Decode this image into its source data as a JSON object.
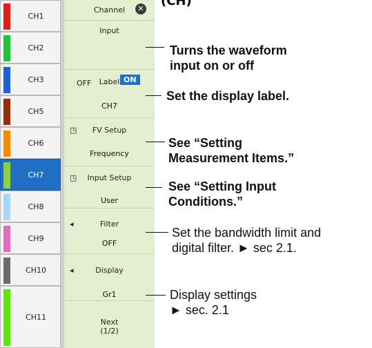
{
  "header_fragment": "(CH)",
  "channels": [
    {
      "label": "CH1",
      "color": "#e81b1b"
    },
    {
      "label": "CH2",
      "color": "#1ec43a"
    },
    {
      "label": "CH3",
      "color": "#1c5fe0"
    },
    {
      "label": "CH5",
      "color": "#9b2d05"
    },
    {
      "label": "CH6",
      "color": "#ff8a00"
    },
    {
      "label": "CH7",
      "color": "#8fd23a"
    },
    {
      "label": "CH8",
      "color": "#a7d6ff"
    },
    {
      "label": "CH9",
      "color": "#e869c2"
    },
    {
      "label": "CH10",
      "color": "#6a6a6a"
    },
    {
      "label": "CH11",
      "color": "#5ce60f"
    }
  ],
  "menu": {
    "title": "Channel",
    "input": {
      "title": "Input",
      "off": "OFF",
      "on": "ON"
    },
    "label": {
      "title": "Label",
      "value": "CH7"
    },
    "fv_setup": {
      "title": "FV Setup",
      "value": "Frequency"
    },
    "input_setup": {
      "title": "Input Setup",
      "value": "User"
    },
    "filter": {
      "title": "Filter",
      "value": "OFF"
    },
    "display": {
      "title": "Display",
      "value": "Gr1"
    },
    "next": {
      "line1": "Next",
      "line2": "(1/2)"
    }
  },
  "annotations": {
    "input_1": "Turns the waveform",
    "input_2": "input on or off",
    "label": "Set the display label.",
    "fv_1": "See “Setting",
    "fv_2": "Measurement Items.”",
    "is_1": "See “Setting Input",
    "is_2": "Conditions.”",
    "filter_1": "Set the bandwidth limit and",
    "filter_2": "digital filter. ► sec 2.1.",
    "display_1": "Display settings",
    "display_2": "► sec. 2.1"
  },
  "icons": {
    "close": "close-icon",
    "left": "left-arrow-icon",
    "submenu": "submenu-icon"
  }
}
